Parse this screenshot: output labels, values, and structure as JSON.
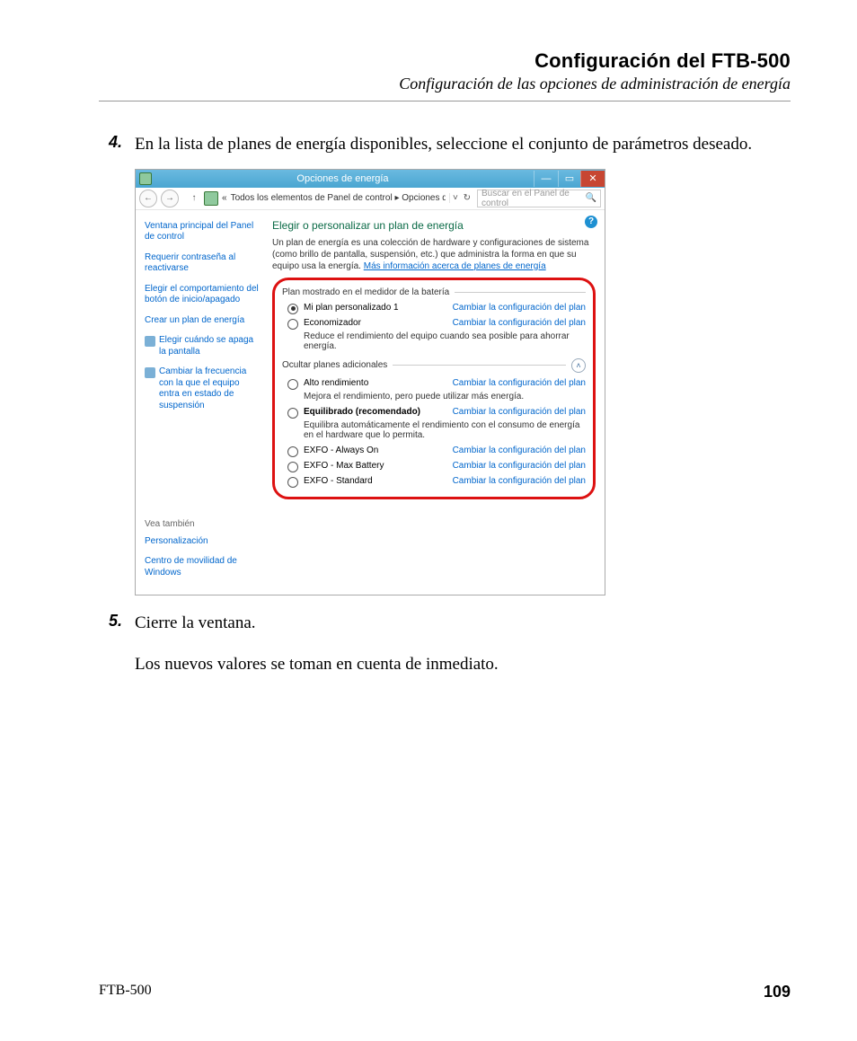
{
  "header": {
    "title": "Configuración del FTB-500",
    "subtitle": "Configuración de las opciones de administración de energía"
  },
  "steps": {
    "s4": {
      "num": "4.",
      "text": "En la lista de planes de energía disponibles, seleccione el conjunto de parámetros deseado."
    },
    "s5": {
      "num": "5.",
      "text": "Cierre la ventana."
    }
  },
  "body_after": "Los nuevos valores se toman en cuenta de inmediato.",
  "footer": {
    "left": "FTB-500",
    "right": "109"
  },
  "win": {
    "title": "Opciones de energía",
    "min": "—",
    "max": "▭",
    "close": "✕",
    "back": "←",
    "fwd": "→",
    "up": "↑",
    "crumb_prefix": "«",
    "crumb": "Todos los elementos de Panel de control ▸ Opciones de energía",
    "refresh_v": "˅",
    "refresh_c": "↻",
    "search_placeholder": "Buscar en el Panel de control",
    "search_icon": "🔍"
  },
  "side": {
    "links": [
      "Ventana principal del Panel de control",
      "Requerir contraseña al reactivarse",
      "Elegir el comportamiento del botón de inicio/apagado",
      "Crear un plan de energía"
    ],
    "icon_links": [
      "Elegir cuándo se apaga la pantalla",
      "Cambiar la frecuencia con la que el equipo entra en estado de suspensión"
    ],
    "see_also": "Vea también",
    "personalization": "Personalización",
    "mobility": "Centro de movilidad de Windows"
  },
  "main": {
    "help": "?",
    "heading": "Elegir o personalizar un plan de energía",
    "desc1": "Un plan de energía es una colección de hardware y configuraciones de sistema (como brillo de pantalla, suspensión, etc.) que administra la forma en que su equipo usa la energía. ",
    "desc_link": "Más información acerca de planes de energía",
    "group1": "Plan mostrado en el medidor de la batería",
    "group2": "Ocultar planes adicionales",
    "change_link": "Cambiar la configuración del plan",
    "collapse": "˄",
    "plans1": [
      {
        "name": "Mi plan personalizado 1",
        "bold": false,
        "desc": "",
        "selected": true
      },
      {
        "name": "Economizador",
        "bold": false,
        "desc": "Reduce el rendimiento del equipo cuando sea posible para ahorrar energía.",
        "selected": false
      }
    ],
    "plans2": [
      {
        "name": "Alto rendimiento",
        "bold": false,
        "desc": "Mejora el rendimiento, pero puede utilizar más energía.",
        "selected": false
      },
      {
        "name": "Equilibrado (recomendado)",
        "bold": true,
        "desc": "Equilibra automáticamente el rendimiento con el consumo de energía en el hardware que lo permita.",
        "selected": false
      },
      {
        "name": "EXFO - Always On",
        "bold": false,
        "desc": "",
        "selected": false
      },
      {
        "name": "EXFO - Max Battery",
        "bold": false,
        "desc": "",
        "selected": false
      },
      {
        "name": "EXFO - Standard",
        "bold": false,
        "desc": "",
        "selected": false
      }
    ]
  }
}
